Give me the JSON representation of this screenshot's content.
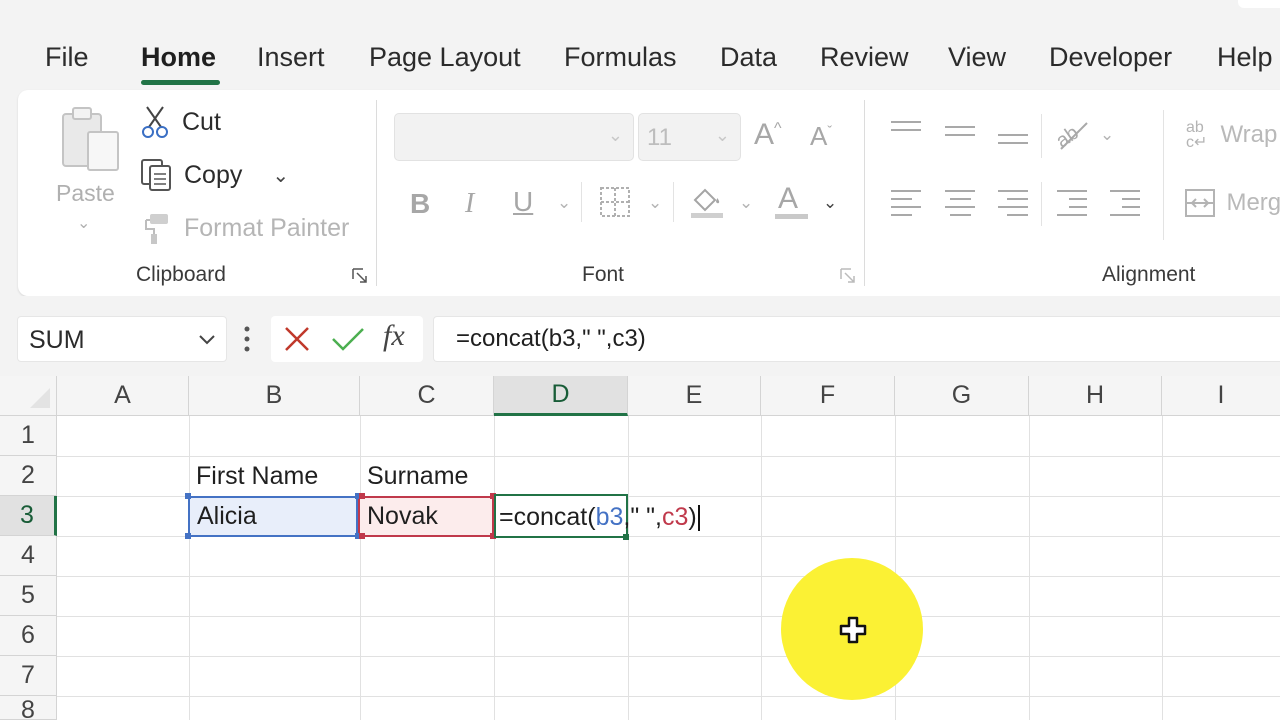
{
  "ribbon_tabs": {
    "file": "File",
    "home": "Home",
    "insert": "Insert",
    "page_layout": "Page Layout",
    "formulas": "Formulas",
    "data": "Data",
    "review": "Review",
    "view": "View",
    "developer": "Developer",
    "help": "Help",
    "active": "Home"
  },
  "clipboard": {
    "paste": "Paste",
    "cut": "Cut",
    "copy": "Copy",
    "format_painter": "Format Painter",
    "group_label": "Clipboard"
  },
  "font": {
    "font_name": "",
    "font_size": "11",
    "bold": "B",
    "italic": "I",
    "underline": "U",
    "group_label": "Font"
  },
  "alignment": {
    "wrap_text": "Wrap",
    "merge": "Merg",
    "group_label": "Alignment"
  },
  "formula_bar": {
    "name_box": "SUM",
    "fx": "fx",
    "formula": "=concat(b3,\" \",c3)"
  },
  "sheet": {
    "columns": [
      "A",
      "B",
      "C",
      "D",
      "E",
      "F",
      "G",
      "H",
      "I"
    ],
    "rows": [
      "1",
      "2",
      "3",
      "4",
      "5",
      "6",
      "7",
      "8"
    ],
    "selected_column": "D",
    "selected_row": "3",
    "cells": {
      "B2": "First Name",
      "C2": "Surname",
      "B3": "Alicia",
      "C3": "Novak"
    },
    "editing": {
      "cell": "D3",
      "prefix": "=concat(",
      "ref1": "b3",
      "middle": ",\" \",",
      "ref2": "c3",
      "suffix": ")"
    }
  },
  "colors": {
    "accent_green": "#217346",
    "ref_blue": "#4472c4",
    "ref_red": "#c0394b",
    "cursor_highlight": "#fbf134"
  }
}
